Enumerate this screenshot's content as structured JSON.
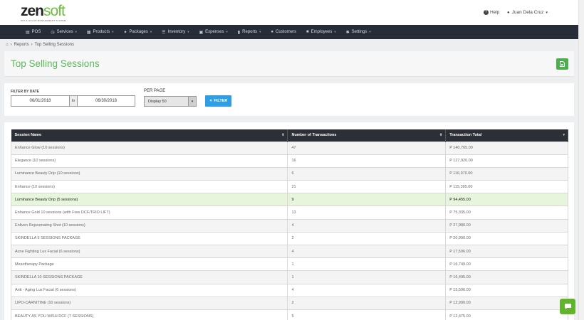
{
  "brand": {
    "name_part1": "zen",
    "name_part2": "soft",
    "tagline": "SPA & SALON MANAGEMENT SYSTEM"
  },
  "header": {
    "help_label": "Help",
    "user_name": "Juan Dela Cruz"
  },
  "nav": [
    {
      "icon": "pos-icon",
      "glyph": "▤",
      "label": "POS",
      "dropdown": false
    },
    {
      "icon": "clock-icon",
      "glyph": "◷",
      "label": "Services",
      "dropdown": true
    },
    {
      "icon": "grid-icon",
      "glyph": "▦",
      "label": "Products",
      "dropdown": true
    },
    {
      "icon": "tag-icon",
      "glyph": "✦",
      "label": "Packages",
      "dropdown": true
    },
    {
      "icon": "list-icon",
      "glyph": "☰",
      "label": "Inventory",
      "dropdown": true
    },
    {
      "icon": "expense-icon",
      "glyph": "▣",
      "label": "Expenses",
      "dropdown": true
    },
    {
      "icon": "chart-icon",
      "glyph": "▮",
      "label": "Reports",
      "dropdown": true
    },
    {
      "icon": "users-icon",
      "glyph": "●",
      "label": "Customers",
      "dropdown": false
    },
    {
      "icon": "employee-icon",
      "glyph": "■",
      "label": "Employees",
      "dropdown": true
    },
    {
      "icon": "gear-icon",
      "glyph": "✱",
      "label": "Settings",
      "dropdown": true
    }
  ],
  "breadcrumb": {
    "items": [
      "Reports",
      "Top Selling Sessions"
    ]
  },
  "page": {
    "title": "Top Selling Sessions"
  },
  "filters": {
    "date_label": "FILTER BY DATE",
    "date_from": "06/01/2018",
    "to_label": "to",
    "date_to": "06/30/2018",
    "per_page_label": "PER PAGE",
    "per_page_value": "Display 50",
    "filter_button": "FILTER"
  },
  "table": {
    "columns": [
      "Session Name",
      "Number of Transactions",
      "Transaction Total"
    ],
    "rows": [
      [
        "Enhance Glow (10 sessions)",
        "47",
        "P 140,765.00"
      ],
      [
        "Elegance (10 sessions)",
        "16",
        "P 127,920.00"
      ],
      [
        "Luminance Beauty Drip (10 sessions)",
        "6",
        "P 116,970.00"
      ],
      [
        "Enhance (10 sessions)",
        "21",
        "P 115,395.00"
      ],
      [
        "Luminance Beauty Drip (5 sessions)",
        "9",
        "P 94,455.00"
      ],
      [
        "Enhance Gold 10 sessions (with Free DCF/TRIO LIFT)",
        "13",
        "P 75,335.00"
      ],
      [
        "Enliven Rejuvenating Shot (10 sessions)",
        "4",
        "P 27,980.00"
      ],
      [
        "SKINDELLA 5 SESSIONS PACKAGE",
        "2",
        "P 20,990.00"
      ],
      [
        "Acne Fighting Lux Facial (6 sessions)",
        "4",
        "P 17,596.00"
      ],
      [
        "Mesotherapy Package",
        "1",
        "P 16,749.00"
      ],
      [
        "SKINDELLA 10 SESSIONS PACKAGE",
        "1",
        "P 16,495.00"
      ],
      [
        "Anti - Aging Lux Facial (6 sessions)",
        "4",
        "P 15,596.00"
      ],
      [
        "LIPO-CARNITINE (10 sessions)",
        "2",
        "P 12,990.00"
      ],
      [
        "BEAUTY AS YOU WISH DCF (7 SESSIONS)",
        "5",
        "P 12,475.00"
      ]
    ],
    "highlighted_row": 4
  },
  "colors": {
    "accent": "#5cb85c",
    "nav_bg": "#272c39",
    "filter_btn": "#2e9ee6"
  }
}
